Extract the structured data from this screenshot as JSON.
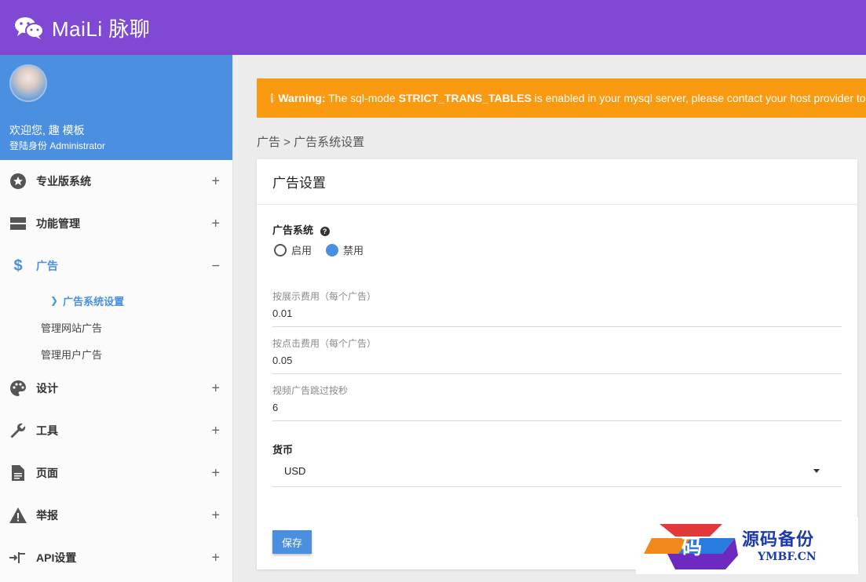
{
  "app": {
    "title": "MaiLi 脉聊"
  },
  "profile": {
    "welcome": "欢迎您, 趣 模板",
    "role": "登陆身份 Administrator"
  },
  "sidebar": {
    "items": [
      {
        "label": "专业版系统",
        "toggle": "+",
        "icon": "star-circle-icon"
      },
      {
        "label": "功能管理",
        "toggle": "+",
        "icon": "layout-icon"
      },
      {
        "label": "广告",
        "toggle": "−",
        "icon": "dollar-icon"
      },
      {
        "label": "设计",
        "toggle": "+",
        "icon": "palette-icon"
      },
      {
        "label": "工具",
        "toggle": "+",
        "icon": "wrench-icon"
      },
      {
        "label": "页面",
        "toggle": "+",
        "icon": "document-icon"
      },
      {
        "label": "举报",
        "toggle": "+",
        "icon": "warning-icon"
      },
      {
        "label": "API设置",
        "toggle": "+",
        "icon": "api-icon"
      }
    ],
    "ads_sub": [
      {
        "label": "广告系统设置"
      },
      {
        "label": "管理网站广告"
      },
      {
        "label": "管理用户广告"
      }
    ]
  },
  "warning": {
    "label": "Warning:",
    "text1": " The sql-mode ",
    "code": "STRICT_TRANS_TABLES",
    "text2": " is enabled in your mysql server, please contact your host provider to di"
  },
  "breadcrumb": "广告 > 广告系统设置",
  "card": {
    "title": "广告设置",
    "ad_system_label": "广告系统",
    "radio_enable": "启用",
    "radio_disable": "禁用",
    "selected": "禁用",
    "fields": [
      {
        "label": "按展示费用（每个广告）",
        "value": "0.01"
      },
      {
        "label": "按点击费用（每个广告）",
        "value": "0.05"
      },
      {
        "label": "视频广告跳过按秒",
        "value": "6"
      }
    ],
    "currency_label": "货币",
    "currency_value": "USD",
    "save_label": "保存"
  },
  "watermark": {
    "text": "源码备份",
    "sub": "YMBF.CN",
    "logo_char": "码"
  },
  "colors": {
    "header": "#8049d4",
    "profile": "#4a8fe0",
    "warning": "#f99a10",
    "accent": "#4a8fe0"
  }
}
